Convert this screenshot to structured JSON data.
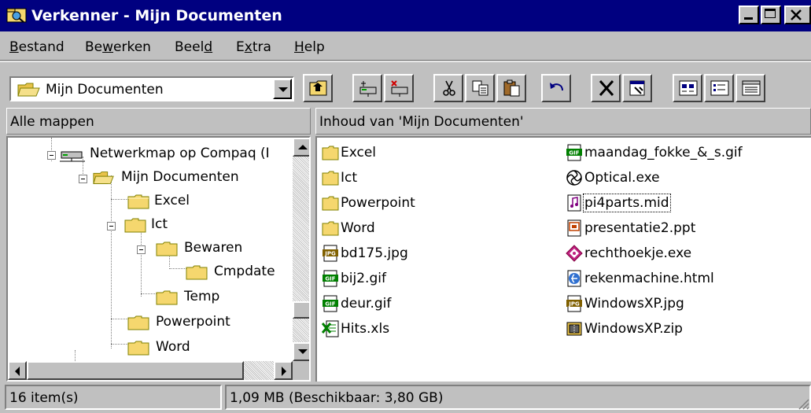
{
  "window": {
    "title": "Verkenner - Mijn Documenten"
  },
  "menu": [
    {
      "pre": "",
      "key": "B",
      "post": "estand"
    },
    {
      "pre": "Be",
      "key": "w",
      "post": "erken"
    },
    {
      "pre": "Beel",
      "key": "d",
      "post": ""
    },
    {
      "pre": "E",
      "key": "x",
      "post": "tra"
    },
    {
      "pre": "",
      "key": "H",
      "post": "elp"
    }
  ],
  "address": {
    "value": "Mijn Documenten"
  },
  "toolbar_icons": [
    "up-folder-icon",
    "map-drive-icon",
    "disconnect-drive-icon",
    "cut-icon",
    "copy-icon",
    "paste-icon",
    "undo-icon",
    "delete-icon",
    "properties-icon",
    "large-icons-icon",
    "list-view-icon",
    "details-view-icon"
  ],
  "panes": {
    "left_header": "Alle mappen",
    "right_header": "Inhoud van 'Mijn Documenten'"
  },
  "tree": [
    {
      "label": "Netwerkmap op Compaq (I",
      "icon": "network-drive-icon",
      "toggle": "minus"
    },
    {
      "label": "Mijn Documenten",
      "icon": "open-folder-icon",
      "toggle": "minus"
    },
    {
      "label": "Excel",
      "icon": "folder-icon",
      "toggle": "none"
    },
    {
      "label": "Ict",
      "icon": "folder-icon",
      "toggle": "minus"
    },
    {
      "label": "Bewaren",
      "icon": "folder-icon",
      "toggle": "minus"
    },
    {
      "label": "Cmpdate",
      "icon": "folder-icon",
      "toggle": "none"
    },
    {
      "label": "Temp",
      "icon": "folder-icon",
      "toggle": "none"
    },
    {
      "label": "Powerpoint",
      "icon": "folder-icon",
      "toggle": "none"
    },
    {
      "label": "Word",
      "icon": "folder-icon",
      "toggle": "none"
    }
  ],
  "files": [
    {
      "name": "Excel",
      "icon": "folder-icon"
    },
    {
      "name": "Ict",
      "icon": "folder-icon"
    },
    {
      "name": "Powerpoint",
      "icon": "folder-icon"
    },
    {
      "name": "Word",
      "icon": "folder-icon"
    },
    {
      "name": "bd175.jpg",
      "icon": "jpg-file-icon"
    },
    {
      "name": "bij2.gif",
      "icon": "gif-file-icon"
    },
    {
      "name": "deur.gif",
      "icon": "gif-file-icon"
    },
    {
      "name": "Hits.xls",
      "icon": "excel-file-icon"
    },
    {
      "name": "maandag_fokke_&_s.gif",
      "icon": "gif-file-icon"
    },
    {
      "name": "Optical.exe",
      "icon": "exe-file-icon"
    },
    {
      "name": "pi4parts.mid",
      "icon": "midi-file-icon",
      "focus": true
    },
    {
      "name": "presentatie2.ppt",
      "icon": "powerpoint-file-icon"
    },
    {
      "name": "rechthoekje.exe",
      "icon": "exe-file-icon"
    },
    {
      "name": "rekenmachine.html",
      "icon": "html-file-icon"
    },
    {
      "name": "WindowsXP.jpg",
      "icon": "jpg-file-icon"
    },
    {
      "name": "WindowsXP.zip",
      "icon": "zip-file-icon"
    }
  ],
  "status": {
    "count": "16 item(s)",
    "size": "1,09 MB (Beschikbaar: 3,80 GB)"
  },
  "colors": {
    "titlebar": "#000080",
    "face": "#c0c0c0",
    "folder": "#f5d76e"
  }
}
